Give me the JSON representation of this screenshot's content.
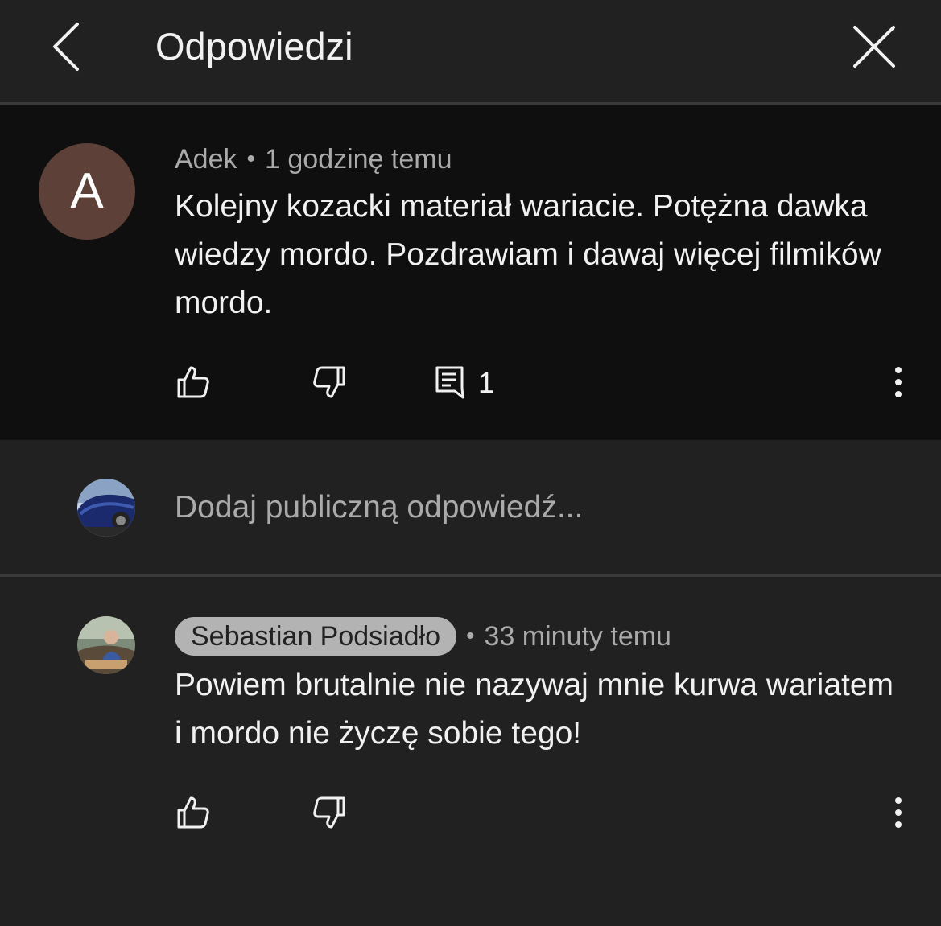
{
  "header": {
    "title": "Odpowiedzi"
  },
  "parent_comment": {
    "avatar_letter": "A",
    "author": "Adek",
    "separator": "•",
    "time": "1 godzinę temu",
    "text": "Kolejny kozacki materiał wariacie. Potężna dawka wiedzy mordo. Pozdrawiam i dawaj więcej filmików mordo.",
    "reply_count": "1",
    "avatar_color": "#5d4037"
  },
  "add_reply": {
    "placeholder": "Dodaj publiczną odpowiedź..."
  },
  "reply": {
    "author": "Sebastian Podsiadło",
    "separator": "•",
    "time": "33 minuty temu",
    "text": "Powiem brutalnie nie nazywaj mnie kurwa wariatem i mordo nie życzę sobie tego!"
  },
  "icons": {
    "back": "chevron-left-icon",
    "close": "close-icon",
    "like": "thumb-up-icon",
    "dislike": "thumb-down-icon",
    "replies": "comment-icon",
    "more": "more-vertical-icon"
  },
  "colors": {
    "background": "#212121",
    "comment_highlight": "#0f0f0f",
    "text_primary": "#f1f1f1",
    "text_secondary": "#aaaaaa",
    "author_chip": "#b3b3b3"
  }
}
